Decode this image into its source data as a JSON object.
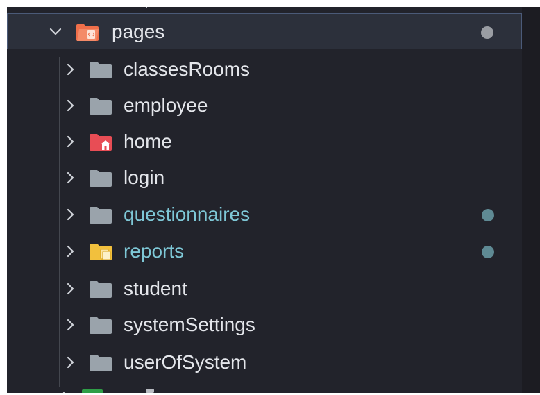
{
  "explorer": {
    "parent": {
      "label": "pages",
      "expanded": true,
      "icon": "folder-open-pages-icon",
      "status_dot_color": "#9a9da3"
    },
    "children": [
      {
        "label": "classesRooms",
        "icon": "folder-icon",
        "modified": false
      },
      {
        "label": "employee",
        "icon": "folder-icon",
        "modified": false
      },
      {
        "label": "home",
        "icon": "folder-home-icon",
        "modified": false
      },
      {
        "label": "login",
        "icon": "folder-icon",
        "modified": false
      },
      {
        "label": "questionnaires",
        "icon": "folder-icon",
        "modified": true
      },
      {
        "label": "reports",
        "icon": "folder-reports-icon",
        "modified": true
      },
      {
        "label": "student",
        "icon": "folder-icon",
        "modified": false
      },
      {
        "label": "systemSettings",
        "icon": "folder-icon",
        "modified": false
      },
      {
        "label": "userOfSystem",
        "icon": "folder-icon",
        "modified": false
      }
    ],
    "colors": {
      "background": "#22232b",
      "selected_background": "#2c303b",
      "selected_border": "#4b5a78",
      "text": "#e4e6eb",
      "modified_text": "#7ec7d6",
      "modified_dot": "#5f8a94",
      "folder_gray": "#9aa3ab",
      "folder_home": "#e84d55",
      "folder_reports": "#f2c03d",
      "folder_pages": "#f06f4a"
    }
  }
}
